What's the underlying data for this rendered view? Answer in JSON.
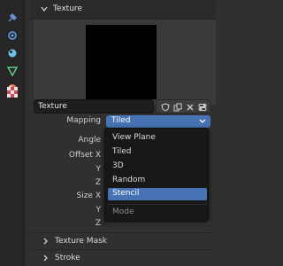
{
  "sidebar": {
    "icons": [
      "tool-icon",
      "particles-icon",
      "physics-icon",
      "constraints-icon",
      "data-icon",
      "material-icon",
      "texture-icon"
    ],
    "colors": [
      "#6b8fd6",
      "#5ea1e8",
      "#6bc2ea",
      "#5dc98f",
      "#e07a52",
      "#d45a5a",
      "#c44d5e"
    ]
  },
  "texture_panel": {
    "title": "Texture",
    "name_value": "Texture"
  },
  "fields": {
    "mapping_label": "Mapping",
    "mapping_value": "Tiled",
    "angle_label": "Angle",
    "offset_x_label": "Offset X",
    "offset_y_label": "Y",
    "offset_z_label": "Z",
    "size_x_label": "Size X",
    "size_y_label": "Y",
    "size_z_label": "Z"
  },
  "dropdown": {
    "items": [
      "View Plane",
      "Tiled",
      "3D",
      "Random",
      "Stencil"
    ],
    "active_index": 4,
    "title": "Mode"
  },
  "subpanels": {
    "texture_mask": "Texture Mask",
    "stroke": "Stroke"
  },
  "accent": "#4772b3"
}
